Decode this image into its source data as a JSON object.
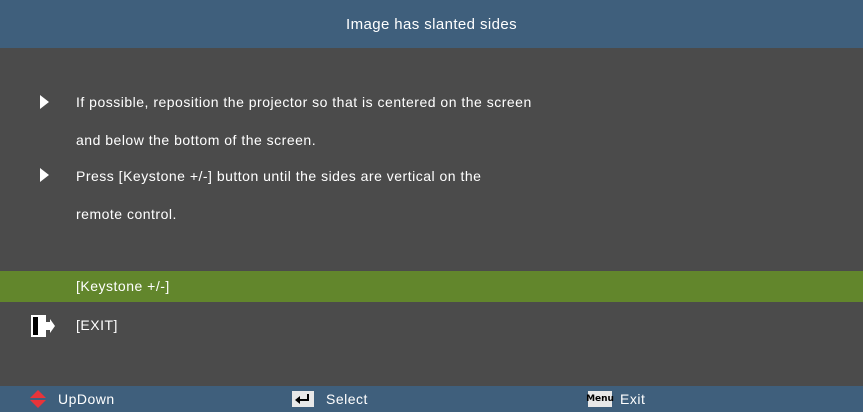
{
  "header": {
    "title": "Image has slanted sides"
  },
  "tips": [
    {
      "lines": [
        "If possible, reposition the projector so that is centered on the screen",
        "and below the bottom of the screen."
      ]
    },
    {
      "lines": [
        "Press [Keystone +/-] button until the sides are vertical on the",
        "remote control."
      ]
    }
  ],
  "menu": {
    "items": [
      {
        "label": "[Keystone +/-]",
        "selected": true
      },
      {
        "label": "[EXIT]",
        "icon": "exit-icon"
      }
    ]
  },
  "footer": {
    "updown": {
      "label": "UpDown",
      "icon": "updown-arrows-icon"
    },
    "select": {
      "label": "Select",
      "icon": "enter-key-icon"
    },
    "exit": {
      "label": "Exit",
      "icon": "menu-key-icon",
      "key_text": "Menu"
    }
  },
  "colors": {
    "header_bar": "#3f5f7c",
    "background": "#4b4b4b",
    "selected_item": "#62862c",
    "updown_icon": "#e8343a"
  }
}
